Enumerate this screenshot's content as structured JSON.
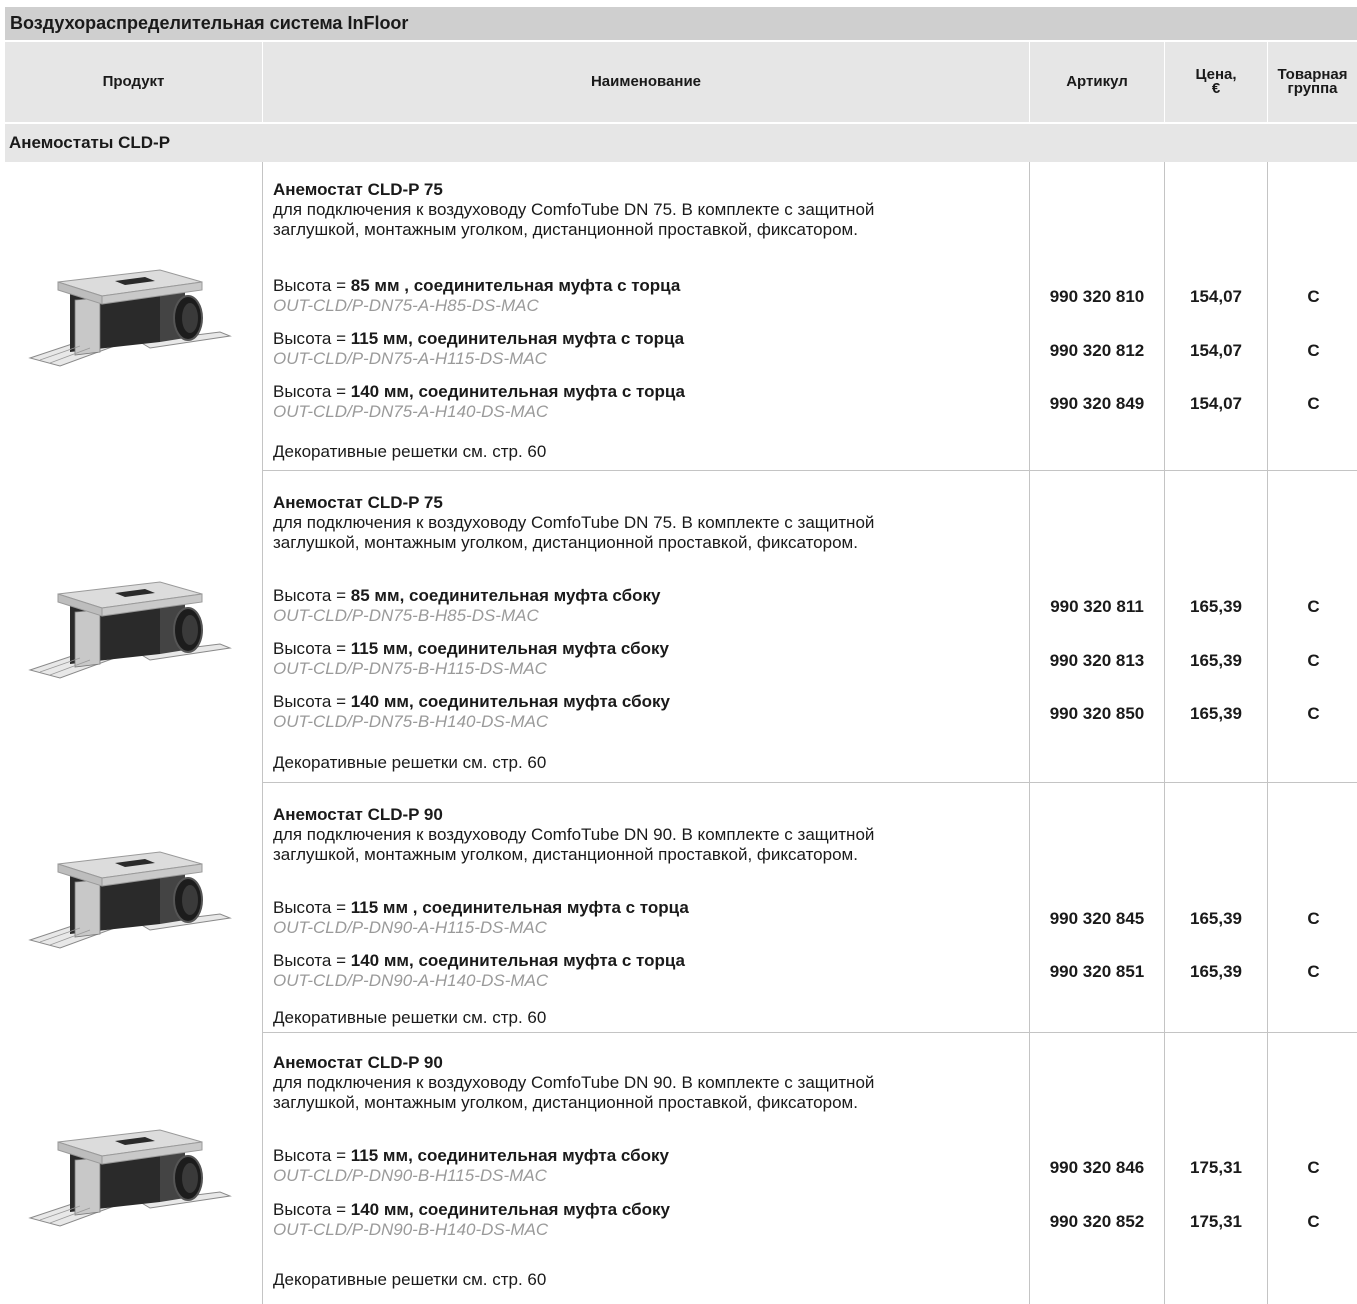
{
  "title": "Воздухораспределительная система InFloor",
  "columns": {
    "product": "Продукт",
    "name": "Наименование",
    "article": "Артикул",
    "price": "Цена, €",
    "price_line1": "Цена,",
    "price_line2": "€",
    "group_line1": "Товарная",
    "group_line2": "группа"
  },
  "section_title": "Анемостаты CLD-P",
  "groups": [
    {
      "title": "Анемостат CLD-P 75",
      "desc_line1": "для подключения к воздуховоду ComfoTube DN 75. В комплекте с защитной",
      "desc_line2": "заглушкой, монтажным уголком, дистанционной проставкой, фиксатором.",
      "variants": [
        {
          "prefix": "Высота = ",
          "height": "85 мм",
          "suffix": " , соединительная муфта с торца",
          "code": "OUT-CLD/P-DN75-A-H85-DS-MAC",
          "article": "990 320 810",
          "price": "154,07",
          "group": "C"
        },
        {
          "prefix": "Высота = ",
          "height": "115 мм",
          "suffix": ", соединительная муфта с торца",
          "code": "OUT-CLD/P-DN75-A-H115-DS-MAC",
          "article": "990 320 812",
          "price": "154,07",
          "group": "C"
        },
        {
          "prefix": "Высота = ",
          "height": "140 мм",
          "suffix": ", соединительная муфта с торца",
          "code": "OUT-CLD/P-DN75-A-H140-DS-MAC",
          "article": "990 320 849",
          "price": "154,07",
          "group": "C"
        }
      ],
      "note": "Декоративные решетки см. стр. 60"
    },
    {
      "title": "Анемостат CLD-P 75",
      "desc_line1": "для подключения к воздуховоду ComfoTube DN 75. В комплекте с защитной",
      "desc_line2": "заглушкой, монтажным уголком, дистанционной проставкой, фиксатором.",
      "variants": [
        {
          "prefix": "Высота = ",
          "height": "85 мм",
          "suffix": ", соединительная муфта сбоку",
          "code": "OUT-CLD/P-DN75-B-H85-DS-MAC",
          "article": "990 320 811",
          "price": "165,39",
          "group": "C"
        },
        {
          "prefix": "Высота = ",
          "height": "115 мм",
          "suffix": ", соединительная муфта сбоку",
          "code": "OUT-CLD/P-DN75-B-H115-DS-MAC",
          "article": "990 320 813",
          "price": "165,39",
          "group": "C"
        },
        {
          "prefix": "Высота = ",
          "height": "140 мм",
          "suffix": ", соединительная муфта сбоку",
          "code": "OUT-CLD/P-DN75-B-H140-DS-MAC",
          "article": "990 320 850",
          "price": "165,39",
          "group": "C"
        }
      ],
      "note": "Декоративные решетки см. стр. 60"
    },
    {
      "title": "Анемостат CLD-P 90",
      "desc_line1": "для подключения к воздуховоду ComfoTube DN 90. В комплекте с защитной",
      "desc_line2": "заглушкой, монтажным уголком, дистанционной проставкой, фиксатором.",
      "variants": [
        {
          "prefix": "Высота = ",
          "height": "115 мм",
          "suffix": " , соединительная муфта с торца",
          "code": "OUT-CLD/P-DN90-A-H115-DS-MAC",
          "article": "990 320 845",
          "price": "165,39",
          "group": "C"
        },
        {
          "prefix": "Высота = ",
          "height": "140 мм",
          "suffix": ", соединительная муфта с торца",
          "code": "OUT-CLD/P-DN90-A-H140-DS-MAC",
          "article": "990 320 851",
          "price": "165,39",
          "group": "C"
        }
      ],
      "note": "Декоративные решетки см. стр. 60"
    },
    {
      "title": "Анемостат CLD-P 90",
      "desc_line1": "для подключения к воздуховоду ComfoTube DN 90. В комплекте с защитной",
      "desc_line2": "заглушкой, монтажным уголком, дистанционной проставкой, фиксатором.",
      "variants": [
        {
          "prefix": "Высота = ",
          "height": "115 мм",
          "suffix": ", соединительная муфта сбоку",
          "code": "OUT-CLD/P-DN90-B-H115-DS-MAC",
          "article": "990 320 846",
          "price": "175,31",
          "group": "C"
        },
        {
          "prefix": "Высота = ",
          "height": "140 мм",
          "suffix": ", соединительная муфта сбоку",
          "code": "OUT-CLD/P-DN90-B-H140-DS-MAC",
          "article": "990 320 852",
          "price": "175,31",
          "group": "C"
        }
      ],
      "note": "Декоративные решетки см. стр. 60"
    }
  ]
}
